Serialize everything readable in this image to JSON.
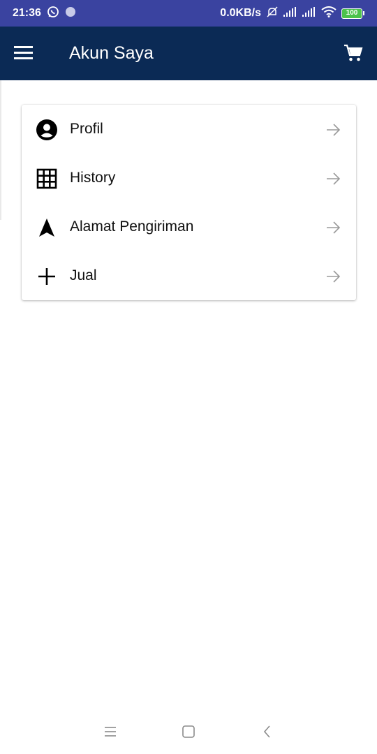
{
  "status_bar": {
    "time": "21:36",
    "net_speed": "0.0KB/s",
    "battery": "100",
    "icons": [
      "whatsapp-icon",
      "notification-dot-icon",
      "mute-icon",
      "signal-icon",
      "signal-icon",
      "wifi-icon",
      "battery-icon"
    ],
    "background": "#3a43a0"
  },
  "app_bar": {
    "title": "Akun Saya",
    "menu_icon": "hamburger-menu-icon",
    "cart_icon": "shopping-cart-icon",
    "background": "#0b2a55"
  },
  "menu": {
    "items": [
      {
        "label": "Profil",
        "icon": "account-circle-icon"
      },
      {
        "label": "History",
        "icon": "grid-icon"
      },
      {
        "label": "Alamat Pengiriman",
        "icon": "navigation-arrow-icon"
      },
      {
        "label": "Jual",
        "icon": "plus-icon"
      }
    ],
    "arrow_icon": "arrow-right-icon"
  },
  "nav_bar": {
    "icons": [
      "recent-apps-icon",
      "home-icon",
      "back-icon"
    ]
  }
}
